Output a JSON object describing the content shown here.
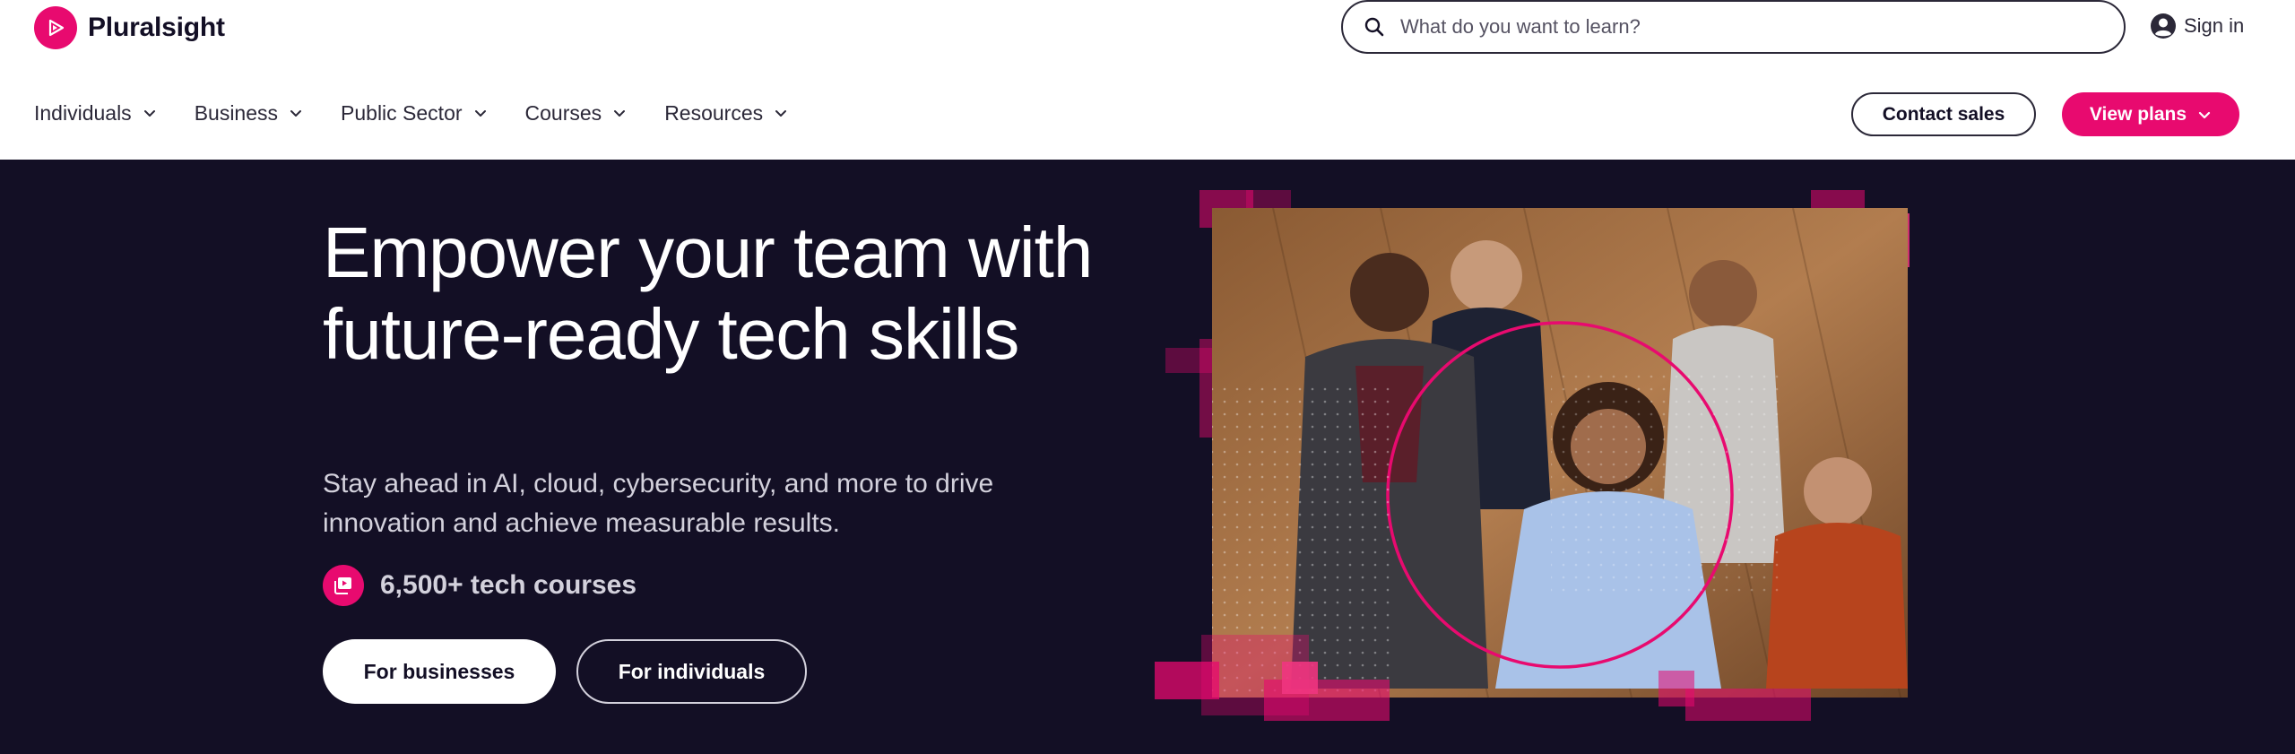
{
  "brand": {
    "name": "Pluralsight",
    "accent": "#e80a6f",
    "background": "#130f25"
  },
  "search": {
    "placeholder": "What do you want to learn?",
    "icon": "search-icon"
  },
  "signin": {
    "label": "Sign in",
    "icon": "user-circle-icon"
  },
  "nav": {
    "items": [
      {
        "label": "Individuals"
      },
      {
        "label": "Business"
      },
      {
        "label": "Public Sector"
      },
      {
        "label": "Courses"
      },
      {
        "label": "Resources"
      }
    ]
  },
  "actions": {
    "contact_sales": "Contact sales",
    "view_plans": "View plans"
  },
  "hero": {
    "title": "Empower your team with future-ready tech skills",
    "subtitle": "Stay ahead in AI, cloud, cybersecurity, and more to drive innovation and achieve measurable results.",
    "courses": "6,500+ tech courses",
    "for_businesses": "For businesses",
    "for_individuals": "For individuals"
  }
}
